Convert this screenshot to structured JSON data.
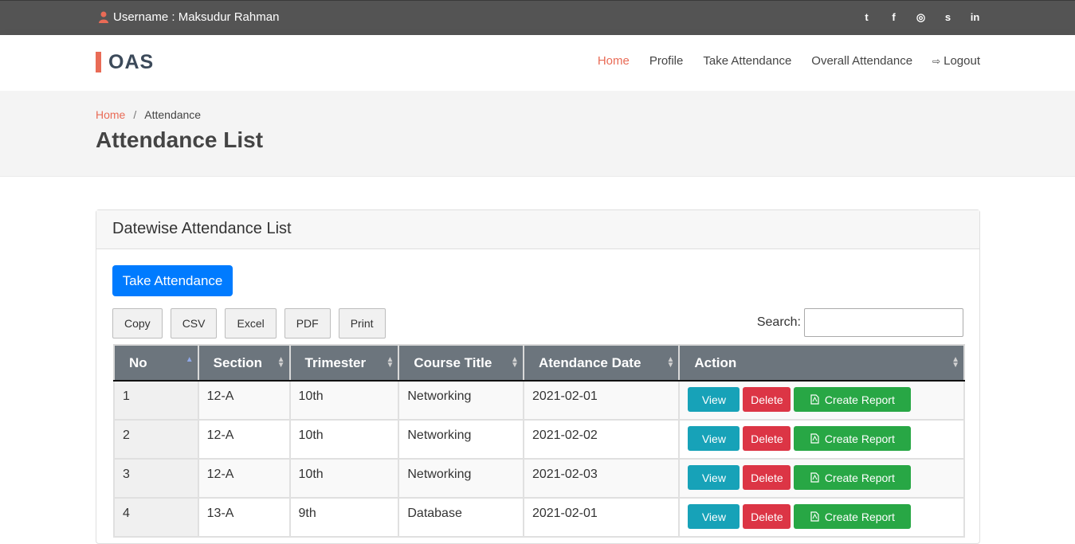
{
  "topbar": {
    "username": "Username : Maksudur Rahman",
    "social": [
      {
        "icon": "twitter-icon",
        "glyph": "t"
      },
      {
        "icon": "facebook-icon",
        "glyph": "f"
      },
      {
        "icon": "instagram-icon",
        "glyph": "◎"
      },
      {
        "icon": "skype-icon",
        "glyph": "s"
      },
      {
        "icon": "linkedin-icon",
        "glyph": "in"
      }
    ]
  },
  "brand": {
    "logo_text": "OAS",
    "accent_color": "#e96b56"
  },
  "nav": {
    "items": [
      "Home",
      "Profile",
      "Take Attendance",
      "Overall Attendance"
    ],
    "logout": "Logout",
    "active": "Home"
  },
  "breadcrumb": {
    "home": "Home",
    "separator": "/",
    "current": "Attendance"
  },
  "page": {
    "title": "Attendance List"
  },
  "card": {
    "header": "Datewise Attendance List",
    "take_button": "Take Attendance",
    "export_buttons": [
      "Copy",
      "CSV",
      "Excel",
      "PDF",
      "Print"
    ],
    "search_label": "Search:",
    "search_value": ""
  },
  "table": {
    "columns": [
      "No",
      "Section",
      "Trimester",
      "Course Title",
      "Atendance Date",
      "Action"
    ],
    "rows": [
      {
        "no": "1",
        "section": "12-A",
        "trimester": "10th",
        "course": "Networking",
        "date": "2021-02-01"
      },
      {
        "no": "2",
        "section": "12-A",
        "trimester": "10th",
        "course": "Networking",
        "date": "2021-02-02"
      },
      {
        "no": "3",
        "section": "12-A",
        "trimester": "10th",
        "course": "Networking",
        "date": "2021-02-03"
      },
      {
        "no": "4",
        "section": "13-A",
        "trimester": "9th",
        "course": "Database",
        "date": "2021-02-01"
      }
    ],
    "actions": {
      "view": "View",
      "delete": "Delete",
      "report": "Create Report"
    }
  }
}
